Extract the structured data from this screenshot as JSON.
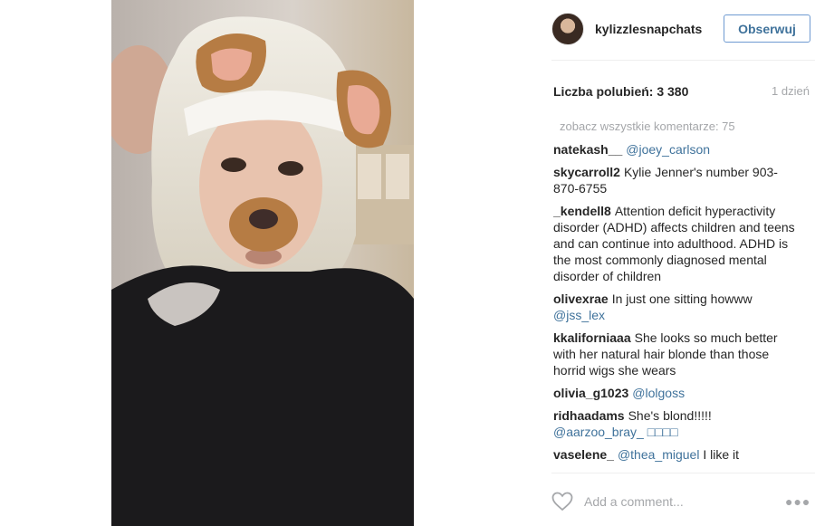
{
  "post": {
    "author": "kylizzlesnapchats",
    "follow_label": "Obserwuj",
    "likes_label": "Liczba polubień: 3 380",
    "time": "1 dzień",
    "view_all": "zobacz wszystkie komentarze: 75"
  },
  "comments": [
    {
      "user": "natekash__",
      "mention": "@joey_carlson",
      "text": ""
    },
    {
      "user": "skycarroll2",
      "mention": "",
      "text": "Kylie Jenner's number 903-870-6755"
    },
    {
      "user": "_kendell8",
      "mention": "",
      "text": "Attention deficit hyperactivity disorder (ADHD) affects children and teens and can continue into adulthood. ADHD is the most commonly diagnosed mental disorder of children"
    },
    {
      "user": "olivexrae",
      "mention": "",
      "text": "In just one sitting howww",
      "mention_after": "@jss_lex"
    },
    {
      "user": "kkaliforniaaa",
      "mention": "",
      "text": "She looks so much better with her natural hair blonde than those horrid wigs she wears"
    },
    {
      "user": "olivia_g1023",
      "mention": "@lolgoss",
      "text": ""
    },
    {
      "user": "ridhaadams",
      "mention": "",
      "text": "She's blond!!!!!",
      "mention_after": "@aarzoo_bray_ □□□□"
    },
    {
      "user": "vaselene_",
      "mention": "@thea_miguel",
      "text": "I like it"
    }
  ],
  "add_comment": {
    "placeholder": "Add a comment..."
  },
  "icons": {
    "like": "heart-outline-icon",
    "options": "more-options-icon"
  },
  "colors": {
    "link": "#3f729b",
    "follow_border": "#6e9ad1",
    "muted": "#a5a7aa"
  }
}
